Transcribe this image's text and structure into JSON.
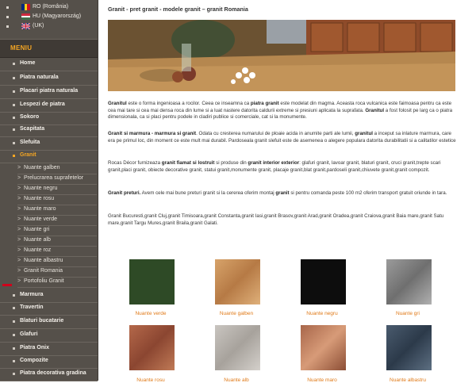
{
  "languages": [
    {
      "label": "RO (România)",
      "flag": "ro"
    },
    {
      "label": "HU (Magyarország)",
      "flag": "hu"
    },
    {
      "label": "(UK)",
      "flag": "uk"
    }
  ],
  "menu": {
    "heading": "MENIU",
    "items": [
      {
        "label": "Home"
      },
      {
        "label": "Piatra naturala"
      },
      {
        "label": "Placari piatra naturala"
      },
      {
        "label": "Lespezi de piatra"
      },
      {
        "label": "Sokoro"
      },
      {
        "label": "Scapitata"
      },
      {
        "label": "Slefuita"
      },
      {
        "label": "Granit",
        "active": true
      }
    ],
    "subitems": [
      {
        "label": "Nuante galben"
      },
      {
        "label": "Prelucrarea suprafetelor"
      },
      {
        "label": "Nuante negru"
      },
      {
        "label": "Nuante rosu"
      },
      {
        "label": "Nuante maro"
      },
      {
        "label": "Nuante verde"
      },
      {
        "label": "Nuante gri"
      },
      {
        "label": "Nuante alb"
      },
      {
        "label": "Nuante roz"
      },
      {
        "label": "Nuante albastru"
      },
      {
        "label": "Granit Romania"
      },
      {
        "label": "Portofoliu Granit"
      }
    ],
    "items_after": [
      {
        "label": "Marmura"
      },
      {
        "label": "Travertin"
      },
      {
        "label": "Blaturi bucatarie"
      },
      {
        "label": "Glafuri"
      },
      {
        "label": "Piatra Onix"
      },
      {
        "label": "Compozite"
      },
      {
        "label": "Piatra decorativa gradina"
      }
    ]
  },
  "page": {
    "title": "Granit - pret granit - modele granit – granit Romania",
    "p1_lead": "Granitul",
    "p1_a": " este o forma ingenioasa a rocilor. Ceea ce inseamna ca ",
    "p1_b": "piatra granit",
    "p1_c": " este modelat din magma. Aceasta roca vulcanica este faimoasa pentru ca este cea mai tare si cea mai densa roca din lume si a luat nastere datorita caldurii extreme si presiuni aplicata la suprafata. ",
    "p1_d": "Granitul",
    "p1_e": " a fost folosit pe larg ca o piatra dimensionala, ca si placi pentru podele in cladiri publice si comerciale, cat si la monumente.",
    "p2_lead": "Granit si marmura - marmura si granit",
    "p2_a": ". Odata cu cresterea numarului de ploaie acida in anumite parti ale lumii, ",
    "p2_b": "granitul",
    "p2_c": " a inceput sa inlature marmura, care era pe primul loc, din moment ce este mult mai durabil. Pardoseala granit slefuit este de asemenea o alegere populara datorita durabilitatii si a calitatilor estetice",
    "p3_a": "Rocas Décor furnizeaza ",
    "p3_b": "granit fiamat si lostruit",
    "p3_c": " si produse din ",
    "p3_d": "granit interior exterior",
    "p3_e": ": glafuri granit, lavoar granit, blaturi granit, cruci granit,trepte scari granit,placi granit, obiecte decorative granit, statui granit,monumente granit, placaje granit,blat granit,pardoseli granit,chiuvete granit,granit compozit.",
    "p4_lead": "Granit preturi.",
    "p4_a": " Avem cele mai bune preturi granit si la cererea oferim montaj ",
    "p4_b": "granit",
    "p4_c": " si pentru comanda peste 100 m2 oferim transport gratuit oriunde in tara.",
    "p5": "Granit Bucuresti,granit Cluj,granit Timisoara,granit Constanta,granit Iasi,granit Brasov,granit Arad,granit Oradea,granit Craiova,granit Baia mare,granit Satu mare,granit Targu Mures,granit Braila,granit Galati."
  },
  "tiles": [
    {
      "label": "Nuante verde",
      "color": "#2e4a26"
    },
    {
      "label": "Nuante galben",
      "color": "#c98f57"
    },
    {
      "label": "Nuante negru",
      "color": "#0d0d0d"
    },
    {
      "label": "Nuante gri",
      "color": "#8a8a8a"
    },
    {
      "label": "Nuante rosu",
      "color": "#a45a3c"
    },
    {
      "label": "Nuante alb",
      "color": "#b8b3ad"
    },
    {
      "label": "Nuante maro",
      "color": "#9a5f42"
    },
    {
      "label": "Nuante albastru",
      "color": "#3a4a5c"
    }
  ]
}
